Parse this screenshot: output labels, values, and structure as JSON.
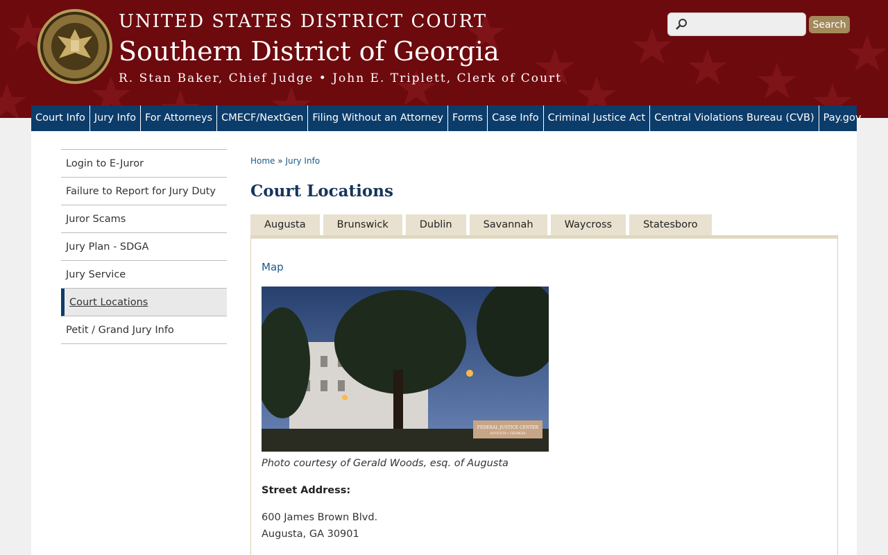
{
  "header": {
    "court_name": "UNITED STATES DISTRICT COURT",
    "district": "Southern District of Georgia",
    "officials": "R. Stan Baker, Chief Judge • John E. Triplett, Clerk of Court",
    "seal_icon": "court-seal-icon"
  },
  "search": {
    "placeholder": "",
    "button_label": "Search"
  },
  "nav": {
    "items": [
      "Court Info",
      "Jury Info",
      "For Attorneys",
      "CMECF/NextGen",
      "Filing Without an Attorney",
      "Forms",
      "Case Info",
      "Criminal Justice Act",
      "Central Violations Bureau (CVB)",
      "Pay.gov"
    ]
  },
  "sidebar": {
    "items": [
      "Login to E-Juror",
      "Failure to Report for Jury Duty",
      "Juror Scams",
      "Jury Plan - SDGA",
      "Jury Service",
      "Court Locations",
      "Petit / Grand Jury Info"
    ],
    "active": "Court Locations"
  },
  "breadcrumb": {
    "home": "Home",
    "separator": "»",
    "current": "Jury Info"
  },
  "page": {
    "title": "Court Locations"
  },
  "tabs": [
    "Augusta",
    "Brunswick",
    "Dublin",
    "Savannah",
    "Waycross",
    "Statesboro"
  ],
  "location": {
    "map_link": "Map",
    "photo_caption": "Photo courtesy of Gerald Woods, esq. of Augusta",
    "address_label": "Street Address:",
    "address_line1": "600 James Brown Blvd.",
    "address_line2": "Augusta, GA 30901",
    "photo_sign": "FEDERAL JUSTICE CENTER",
    "photo_sign_sub": "AUGUSTA • GEORGIA"
  },
  "colors": {
    "header_bg": "#6d0a0e",
    "nav_bg": "#0c3c6a",
    "tab_bg": "#e8e1cf",
    "search_button": "#a38a5b"
  }
}
